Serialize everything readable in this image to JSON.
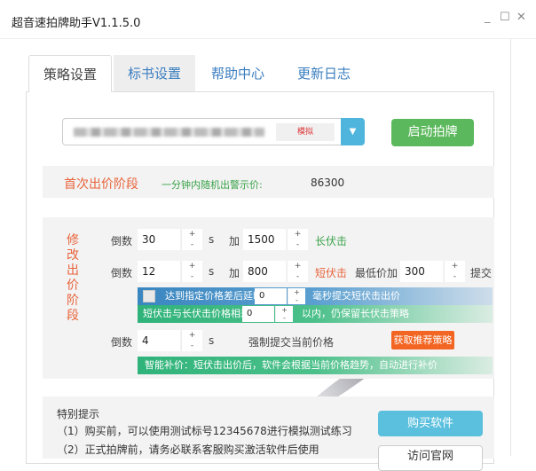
{
  "window": {
    "title": "超音速拍牌助手V1.1.5.0",
    "minimize": "_",
    "maximize": "☐",
    "close": "✕"
  },
  "tabs": [
    {
      "label": "策略设置"
    },
    {
      "label": "标书设置"
    },
    {
      "label": "帮助中心"
    },
    {
      "label": "更新日志"
    }
  ],
  "selector": {
    "mode": "模拟",
    "dropdown_icon": "▼"
  },
  "start_button": "启动拍牌",
  "first_stage": {
    "label": "首次出价阶段",
    "tip": "一分钟内随机出警示价:",
    "value": "86300"
  },
  "modify_stage": {
    "label": "修改出价阶段",
    "row1": {
      "countdown_label": "倒数",
      "countdown": "30",
      "unit": "s",
      "add_label": "加",
      "add": "1500",
      "strategy": "长伏击"
    },
    "row2": {
      "countdown_label": "倒数",
      "countdown": "12",
      "unit": "s",
      "add_label": "加",
      "add": "800",
      "strategy": "短伏击",
      "min_label": "最低价加",
      "min_add": "300",
      "submit": "提交"
    },
    "delay": {
      "text1": "达到指定价格差后延时",
      "value": "0",
      "text2": "毫秒提交短伏击出价"
    },
    "diff": {
      "text1": "短伏击与长伏击价格相差",
      "value": "0",
      "text2": "以内，仍保留长伏击策略"
    },
    "row3": {
      "countdown_label": "倒数",
      "countdown": "4",
      "unit": "s",
      "force": "强制提交当前价格",
      "recommend": "获取推荐策略"
    },
    "smart": "智能补价：短伏击出价后，软件会根据当前价格趋势，自动进行补价",
    "plus": "+",
    "minus": "-"
  },
  "tips": {
    "heading": "特别提示",
    "lines": [
      "（1）购买前，可以使用测试标号12345678进行模拟测试练习",
      "（2）正式拍牌前，请务必联系客服购买激活软件后使用"
    ]
  },
  "buy_button": "购买软件",
  "visit_button": "访问官网"
}
